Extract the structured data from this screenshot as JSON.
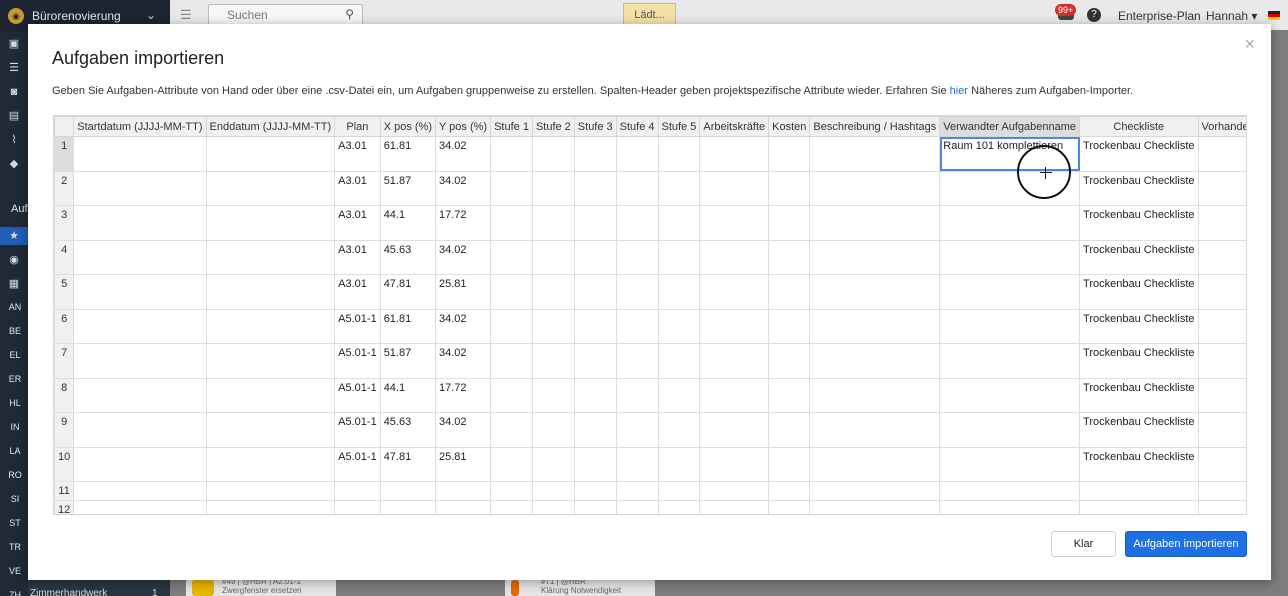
{
  "app": {
    "project_name": "Bürorenovierung",
    "search_placeholder": "Suchen",
    "loading_label": "Lädt...",
    "notification_count": "99+",
    "plan_label": "Enterprise-Plan",
    "user_name": "Hannah",
    "sidebar_section_label": "Auf",
    "sidebar_abbrs": [
      "AN",
      "BE",
      "EL",
      "ER",
      "HL",
      "IN",
      "LA",
      "RO",
      "SI",
      "ST",
      "TR",
      "VE",
      "ZH"
    ],
    "sidebar_bottom_label": "Zimmerhandwerk",
    "sidebar_bottom_count": "1",
    "bg_cards": [
      {
        "text": "#49 | @HBR | A2.01-1",
        "sub": "Zwergfenster ersetzen",
        "color": "#e8b400"
      },
      {
        "text": "#71 | @HBR",
        "sub": "Klärung Notwendigkeit",
        "color": "#e06a00"
      }
    ]
  },
  "modal": {
    "title": "Aufgaben importieren",
    "description_before": "Geben Sie Aufgaben-Attribute von Hand oder über eine .csv-Datei ein, um Aufgaben gruppenweise zu erstellen. Spalten-Header geben projektspezifische Attribute wieder. Erfahren Sie ",
    "description_link": "hier",
    "description_after": " Näheres zum Aufgaben-Importer.",
    "close_label": "×",
    "buttons": {
      "cancel": "Klar",
      "import": "Aufgaben importieren"
    }
  },
  "grid": {
    "columns": [
      "Startdatum (JJJJ-MM-TT)",
      "Enddatum (JJJJ-MM-TT)",
      "Plan",
      "X pos (%)",
      "Y pos (%)",
      "Stufe 1",
      "Stufe 2",
      "Stufe 3",
      "Stufe 4",
      "Stufe 5",
      "Arbeitskräfte",
      "Kosten",
      "Beschreibung / Hashtags",
      "Verwandter Aufgabenname",
      "Checkliste",
      "Vorhandene Datei"
    ],
    "rows": [
      {
        "num": "1",
        "cells": [
          "",
          "",
          "A3.01",
          "61.81",
          "34.02",
          "",
          "",
          "",
          "",
          "",
          "",
          "",
          "",
          "Raum 101 komplettieren",
          "Trockenbau Checkliste",
          ""
        ]
      },
      {
        "num": "2",
        "cells": [
          "",
          "",
          "A3.01",
          "51.87",
          "34.02",
          "",
          "",
          "",
          "",
          "",
          "",
          "",
          "",
          "",
          "Trockenbau Checkliste",
          ""
        ]
      },
      {
        "num": "3",
        "cells": [
          "",
          "",
          "A3.01",
          "44.1",
          "17.72",
          "",
          "",
          "",
          "",
          "",
          "",
          "",
          "",
          "",
          "Trockenbau Checkliste",
          ""
        ]
      },
      {
        "num": "4",
        "cells": [
          "",
          "",
          "A3.01",
          "45.63",
          "34.02",
          "",
          "",
          "",
          "",
          "",
          "",
          "",
          "",
          "",
          "Trockenbau Checkliste",
          ""
        ]
      },
      {
        "num": "5",
        "cells": [
          "",
          "",
          "A3.01",
          "47.81",
          "25.81",
          "",
          "",
          "",
          "",
          "",
          "",
          "",
          "",
          "",
          "Trockenbau Checkliste",
          ""
        ]
      },
      {
        "num": "6",
        "cells": [
          "",
          "",
          "A5.01-1",
          "61.81",
          "34.02",
          "",
          "",
          "",
          "",
          "",
          "",
          "",
          "",
          "",
          "Trockenbau Checkliste",
          ""
        ]
      },
      {
        "num": "7",
        "cells": [
          "",
          "",
          "A5.01-1",
          "51.87",
          "34.02",
          "",
          "",
          "",
          "",
          "",
          "",
          "",
          "",
          "",
          "Trockenbau Checkliste",
          ""
        ]
      },
      {
        "num": "8",
        "cells": [
          "",
          "",
          "A5.01-1",
          "44.1",
          "17.72",
          "",
          "",
          "",
          "",
          "",
          "",
          "",
          "",
          "",
          "Trockenbau Checkliste",
          ""
        ]
      },
      {
        "num": "9",
        "cells": [
          "",
          "",
          "A5.01-1",
          "45.63",
          "34.02",
          "",
          "",
          "",
          "",
          "",
          "",
          "",
          "",
          "",
          "Trockenbau Checkliste",
          ""
        ]
      },
      {
        "num": "10",
        "cells": [
          "",
          "",
          "A5.01-1",
          "47.81",
          "25.81",
          "",
          "",
          "",
          "",
          "",
          "",
          "",
          "",
          "",
          "Trockenbau Checkliste",
          ""
        ]
      },
      {
        "num": "11",
        "cells": [
          "",
          "",
          "",
          "",
          "",
          "",
          "",
          "",
          "",
          "",
          "",
          "",
          "",
          "",
          "",
          ""
        ]
      },
      {
        "num": "12",
        "cells": [
          "",
          "",
          "",
          "",
          "",
          "",
          "",
          "",
          "",
          "",
          "",
          "",
          "",
          "",
          "",
          ""
        ]
      }
    ]
  }
}
